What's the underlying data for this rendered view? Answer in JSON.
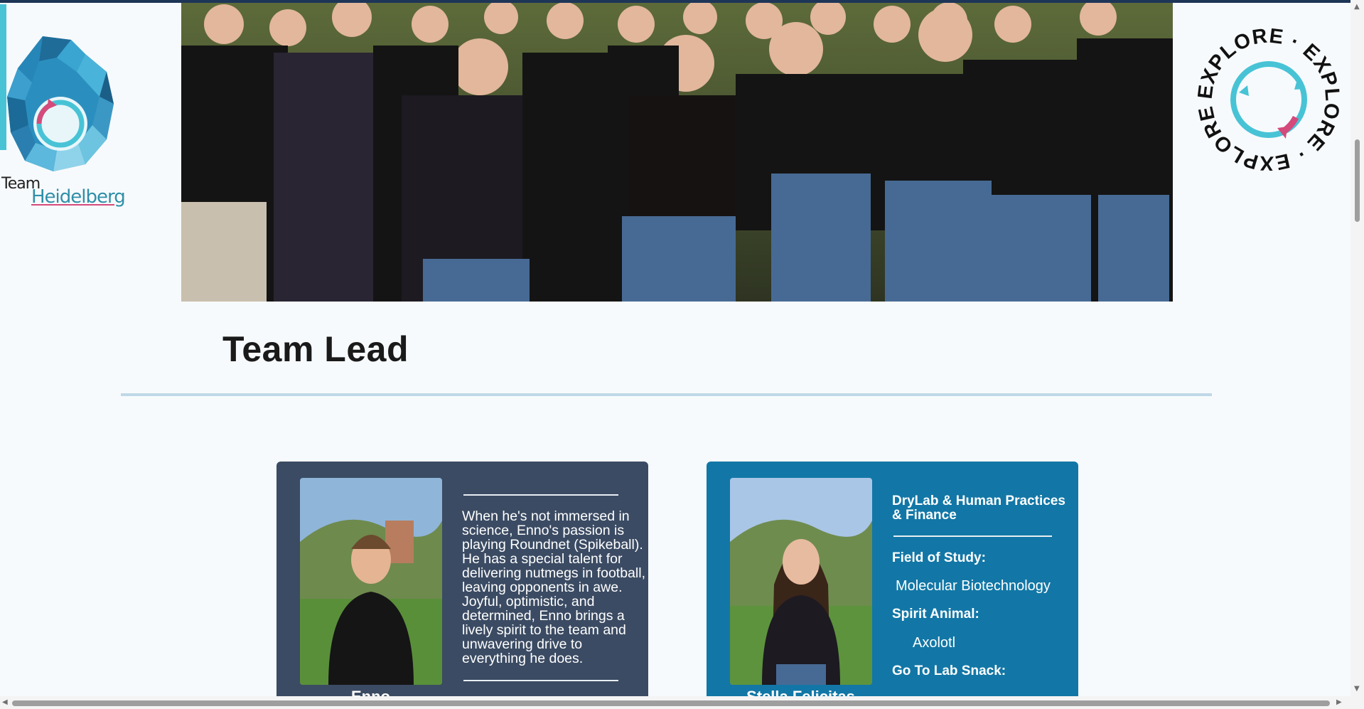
{
  "logo": {
    "team_label": "Team",
    "city_label": "Heidelberg",
    "icon": "polygon-spiral-logo-icon"
  },
  "badge": {
    "text": "EXPLORE · EXPLORE · EXPLORE ·",
    "icon": "recycle-circle-icon"
  },
  "hero": {
    "icon": "team-group-photo"
  },
  "section": {
    "title": "Team Lead"
  },
  "cards": [
    {
      "name": "Enno",
      "bio": "When he's not immersed in science, Enno's passion is playing Roundnet (Spikeball). He has a special talent for delivering nutmegs in football, leaving opponents in awe. Joyful, optimistic, and determined, Enno brings a lively spirit to the team and unwavering drive to everything he does.",
      "color": "#3b4b63"
    },
    {
      "name": "Stella Felicitas",
      "role": "DryLab & Human Practices & Finance",
      "field_of_study_label": "Field of Study:",
      "field_of_study": "Molecular Biotechnology",
      "spirit_animal_label": "Spirit Animal:",
      "spirit_animal": "Axolotl",
      "lab_snack_label": "Go To Lab Snack:",
      "color": "#1277a6"
    }
  ],
  "colors": {
    "accent_teal": "#48c3d6",
    "accent_pink": "#d44a7b",
    "rule": "#bfd8e8"
  }
}
